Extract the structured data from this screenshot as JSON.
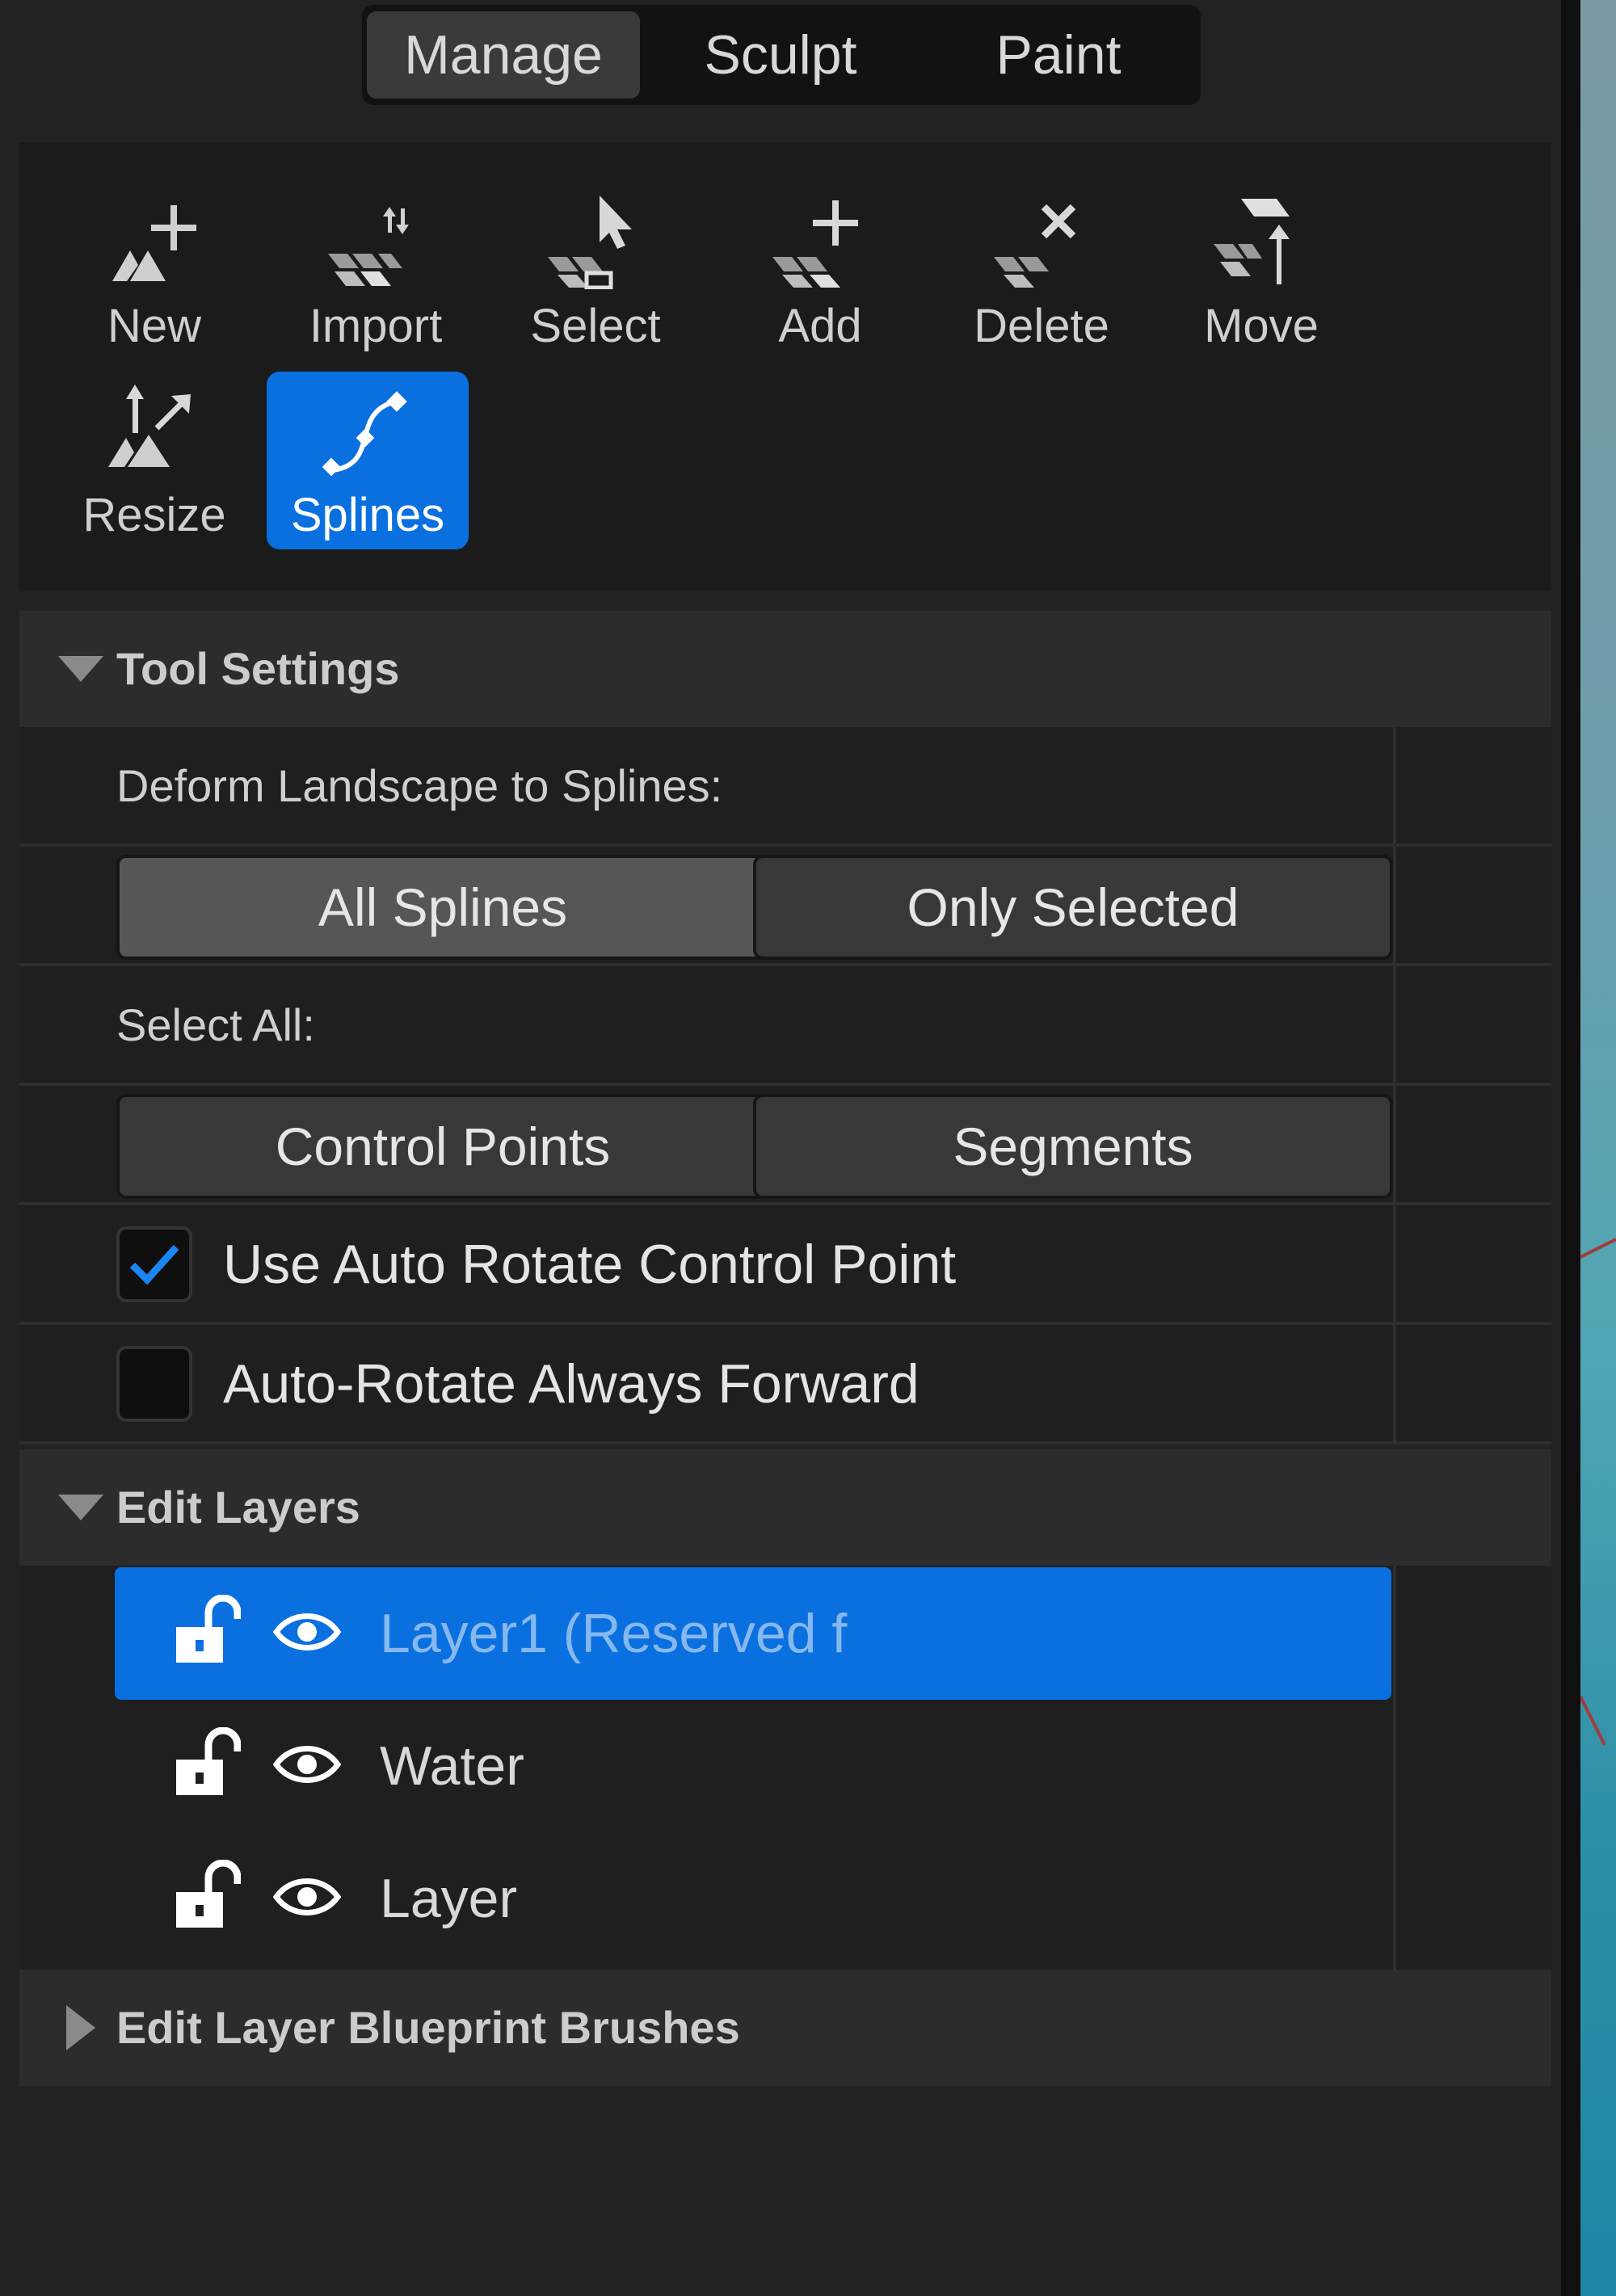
{
  "mode_tabs": [
    {
      "label": "Manage",
      "active": true
    },
    {
      "label": "Sculpt",
      "active": false
    },
    {
      "label": "Paint",
      "active": false
    }
  ],
  "tools": [
    {
      "label": "New",
      "icon": "new-icon",
      "active": false
    },
    {
      "label": "Import",
      "icon": "import-icon",
      "active": false
    },
    {
      "label": "Select",
      "icon": "select-icon",
      "active": false
    },
    {
      "label": "Add",
      "icon": "add-icon",
      "active": false
    },
    {
      "label": "Delete",
      "icon": "delete-icon",
      "active": false
    },
    {
      "label": "Move",
      "icon": "move-icon",
      "active": false
    },
    {
      "label": "Resize",
      "icon": "resize-icon",
      "active": false
    },
    {
      "label": "Splines",
      "icon": "splines-icon",
      "active": true
    }
  ],
  "tool_settings": {
    "title": "Tool Settings",
    "deform_label": "Deform Landscape to Splines:",
    "deform_options": [
      "All Splines",
      "Only Selected"
    ],
    "deform_selected": "All Splines",
    "select_all_label": "Select All:",
    "select_all_options": [
      "Control Points",
      "Segments"
    ],
    "checkboxes": [
      {
        "label": "Use Auto Rotate Control Point",
        "checked": true
      },
      {
        "label": "Auto-Rotate Always Forward",
        "checked": false
      }
    ]
  },
  "edit_layers": {
    "title": "Edit Layers",
    "layers": [
      {
        "name": "Layer1 (Reserved f",
        "selected": true,
        "locked": false,
        "visible": true
      },
      {
        "name": "Water",
        "selected": false,
        "locked": false,
        "visible": true
      },
      {
        "name": "Layer",
        "selected": false,
        "locked": false,
        "visible": true
      }
    ]
  },
  "blueprint_brushes": {
    "title": "Edit Layer Blueprint Brushes",
    "expanded": false
  },
  "colors": {
    "accent": "#0a70e0",
    "panel_bg": "#222222",
    "header_bg": "#2c2c2c"
  }
}
